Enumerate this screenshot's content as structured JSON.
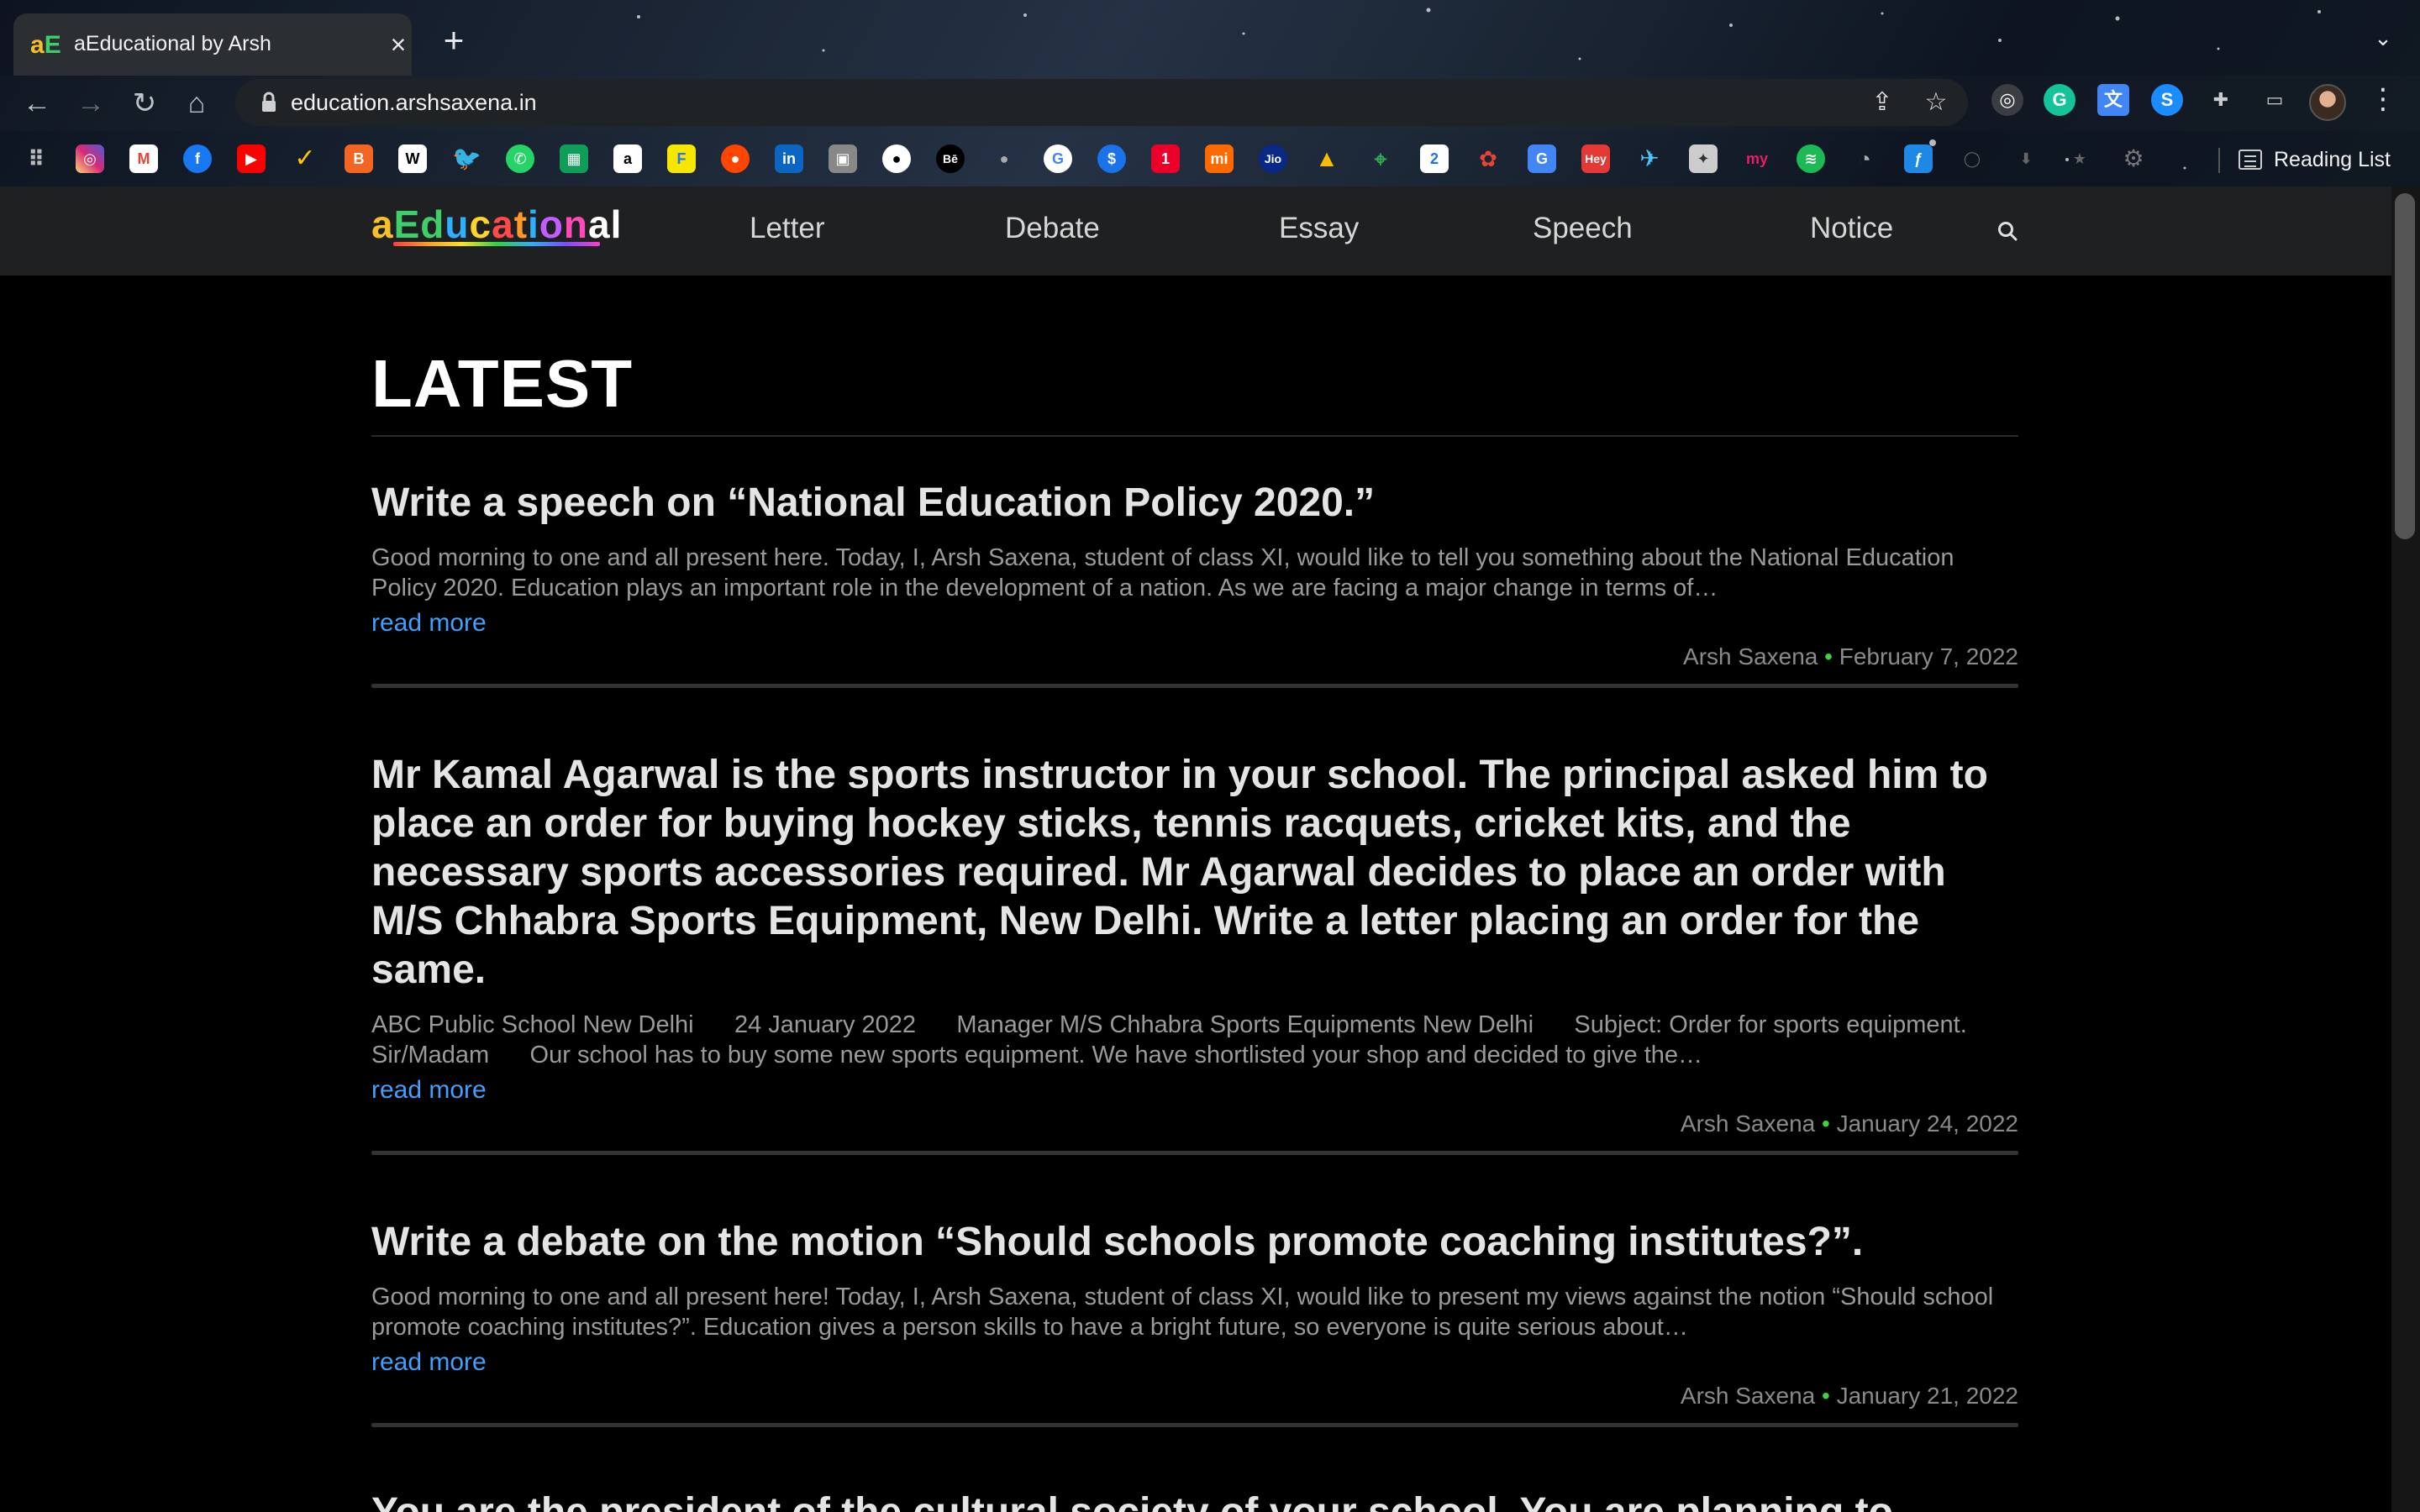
{
  "browser": {
    "tab_title": "aEducational by Arsh",
    "tab_favicon_a": "a",
    "tab_favicon_e": "E",
    "url": "education.arshsaxena.in",
    "reading_list_label": "Reading List"
  },
  "site": {
    "logo": "aEducational",
    "nav": [
      "Letter",
      "Debate",
      "Essay",
      "Speech",
      "Notice"
    ]
  },
  "main": {
    "heading": "LATEST",
    "posts": [
      {
        "title": "Write a speech on “National Education Policy 2020.”",
        "excerpt": "Good morning to one and all present here. Today, I, Arsh Saxena, student of class XI, would like to tell you something about the National Education Policy 2020. Education plays an important role in the development of a nation. As we are facing a major change in terms of…",
        "read_more": "read more",
        "author": "Arsh Saxena",
        "separator": "•",
        "date": "February 7, 2022"
      },
      {
        "title": "Mr Kamal Agarwal is the sports instructor in your school. The principal asked him to place an order for buying hockey sticks, tennis racquets, cricket kits, and the necessary sports accessories required. Mr Agarwal decides to place an order with M/S Chhabra Sports Equipment, New Delhi. Write a letter placing an order for the same.",
        "excerpt": "ABC Public School New Delhi      24 January 2022      Manager M/S Chhabra Sports Equipments New Delhi      Subject: Order for sports equipment.      Sir/Madam      Our school has to buy some new sports equipment. We have shortlisted your shop and decided to give the…",
        "read_more": "read more",
        "author": "Arsh Saxena",
        "separator": "•",
        "date": "January 24, 2022"
      },
      {
        "title": "Write a debate on the motion “Should schools promote coaching institutes?”.",
        "excerpt": "Good morning to one and all present here! Today, I, Arsh Saxena, student of class XI, would like to present my views against the notion “Should school promote coaching institutes?”. Education gives a person skills to have a bright future, so everyone is quite serious about…",
        "read_more": "read more",
        "author": "Arsh Saxena",
        "separator": "•",
        "date": "January 21, 2022"
      },
      {
        "title": "You are the president of the cultural society of your school. You are planning to"
      }
    ]
  },
  "colors": {
    "link": "#3fa0ff",
    "meta_dot": "#3fd23a",
    "header_bg": "#1f2021",
    "page_bg": "#000000"
  }
}
